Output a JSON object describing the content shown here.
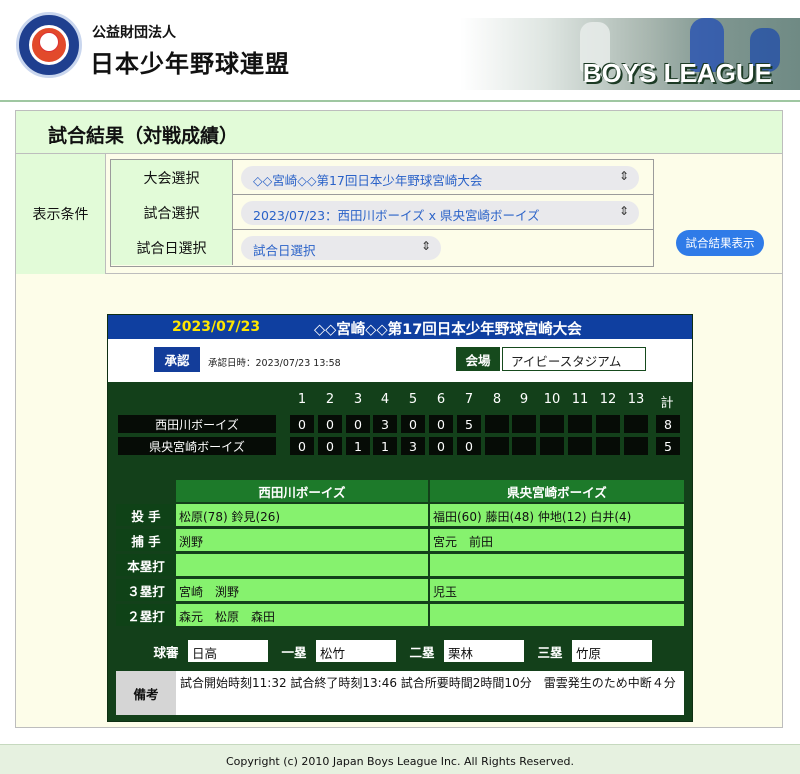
{
  "header": {
    "org_sub": "公益財団法人",
    "org_name": "日本少年野球連盟",
    "logo_text": "BOYS LEAGUE",
    "banner_title": "BOYS LEAGUE"
  },
  "page": {
    "title": "試合結果（対戦成績）"
  },
  "conditions": {
    "label": "表示条件",
    "tournament_label": "大会選択",
    "tournament_value": "◇◇宮崎◇◇第17回日本少年野球宮崎大会",
    "game_label": "試合選択",
    "game_value": "2023/07/23：西田川ボーイズ x 県央宮崎ボーイズ",
    "date_label": "試合日選択",
    "date_placeholder": "試合日選択",
    "show_button": "試合結果表示"
  },
  "result": {
    "date": "2023/07/23",
    "tournament": "◇◇宮崎◇◇第17回日本少年野球宮崎大会",
    "approval_badge": "承認",
    "approval_time": "承認日時：2023/07/23 13:58",
    "venue_label": "会場",
    "venue": "アイビースタジアム",
    "innings": [
      "1",
      "2",
      "3",
      "4",
      "5",
      "6",
      "7",
      "8",
      "9",
      "10",
      "11",
      "12",
      "13"
    ],
    "total_label": "計",
    "teams": [
      {
        "name": "西田川ボーイズ",
        "scores": [
          "0",
          "0",
          "0",
          "3",
          "0",
          "0",
          "5",
          "",
          "",
          "",
          "",
          "",
          ""
        ],
        "total": "8"
      },
      {
        "name": "県央宮崎ボーイズ",
        "scores": [
          "0",
          "0",
          "1",
          "1",
          "3",
          "0",
          "0",
          "",
          "",
          "",
          "",
          "",
          ""
        ],
        "total": "5"
      }
    ],
    "stats": {
      "team1": "西田川ボーイズ",
      "team2": "県央宮崎ボーイズ",
      "rows": [
        {
          "label": "投 手",
          "team1": "松原(78) 鈴見(26)",
          "team2": "福田(60) 藤田(48) 仲地(12) 白井(4)"
        },
        {
          "label": "捕 手",
          "team1": "渕野",
          "team2": "宮元　前田"
        },
        {
          "label": "本塁打",
          "team1": "",
          "team2": ""
        },
        {
          "label": "３塁打",
          "team1": "宮崎　渕野",
          "team2": "児玉"
        },
        {
          "label": "２塁打",
          "team1": "森元　松原　森田",
          "team2": ""
        }
      ]
    },
    "umpires": [
      {
        "label": "球審",
        "name": "日高"
      },
      {
        "label": "一塁",
        "name": "松竹"
      },
      {
        "label": "二塁",
        "name": "栗林"
      },
      {
        "label": "三塁",
        "name": "竹原"
      }
    ],
    "remarks_label": "備考",
    "remarks": "試合開始時刻11:32 試合終了時刻13:46 試合所要時間2時間10分　雷雲発生のため中断４分"
  },
  "footer": {
    "copyright": "Copyright (c) 2010 Japan Boys League Inc. All Rights Reserved."
  },
  "colors": {
    "header_blue": "#0f3fa0",
    "panel_green": "#13401a",
    "stat_green": "#86f26e",
    "button_blue": "#2f7be8",
    "tournament_yellow": "#ffe600"
  }
}
